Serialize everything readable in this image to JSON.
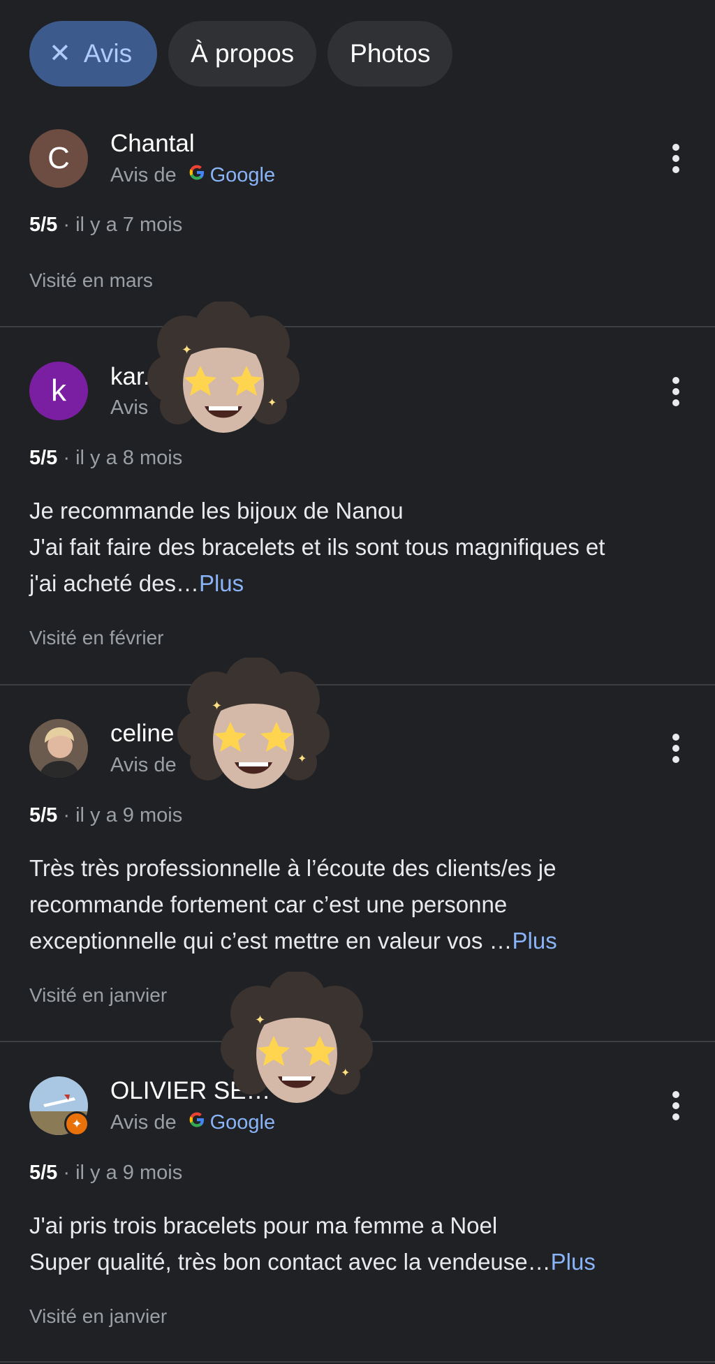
{
  "tabs": [
    {
      "label": "Avis",
      "active": true,
      "icon": "close-icon"
    },
    {
      "label": "À propos",
      "active": false
    },
    {
      "label": "Photos",
      "active": false
    }
  ],
  "reviews": [
    {
      "avatar_letter": "C",
      "avatar_color": "#6d4c41",
      "name": "Chantal",
      "source_prefix": "Avis de",
      "source_brand": "Google",
      "rating": "5/5",
      "time": "· il y a 7 mois",
      "text": "",
      "plus": "",
      "visited": "Visité en mars"
    },
    {
      "avatar_letter": "k",
      "avatar_color": "#7b1fa2",
      "name": "kar.",
      "source_prefix": "Avis",
      "rating": "5/5",
      "time": "· il y a 8 mois",
      "text_lines": [
        "Je recommande les bijoux de Nanou",
        "J'ai fait faire des bracelets et ils sont tous magnifiques et",
        "j'ai acheté des…"
      ],
      "plus": "Plus",
      "visited": "Visité en février"
    },
    {
      "avatar_letter": "",
      "avatar_color": "#8d6e63",
      "name": "celine",
      "source_prefix": "Avis de",
      "rating": "5/5",
      "time": "· il y a 9 mois",
      "text_lines": [
        "Très très professionnelle à l’écoute des clients/es je",
        "recommande fortement car c’est une personne",
        "exceptionnelle qui c’est mettre en valeur vos …"
      ],
      "plus": "Plus",
      "visited": "Visité en janvier"
    },
    {
      "avatar_letter": "",
      "avatar_color": "#90a4ae",
      "name": "OLIVIER SE…",
      "source_prefix": "Avis de",
      "source_brand": "Google",
      "rating": "5/5",
      "time": "· il y a 9 mois",
      "text_lines": [
        "J'ai pris trois bracelets pour ma femme a Noel",
        "Super qualité, très bon contact avec la vendeuse…"
      ],
      "plus": "Plus",
      "visited": "Visité en janvier"
    }
  ],
  "colors": {
    "background": "#202124",
    "link": "#8ab4f8",
    "active_chip": "#3c5a8c"
  }
}
